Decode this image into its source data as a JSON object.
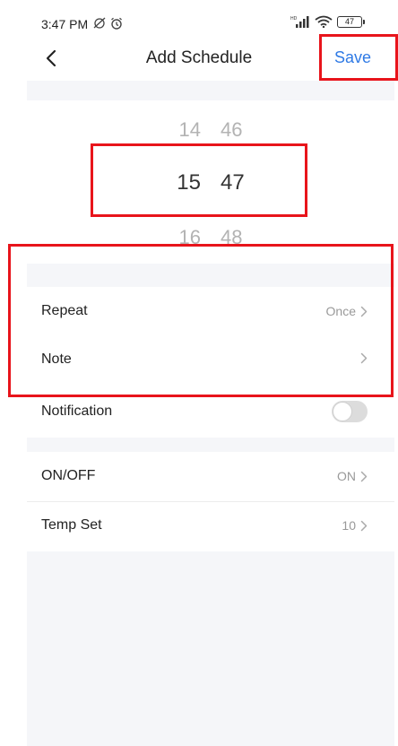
{
  "status_bar": {
    "time": "3:47 PM",
    "icons": [
      "alarm-off-icon",
      "alarm-icon"
    ],
    "battery": "47"
  },
  "header": {
    "title": "Add Schedule",
    "save_label": "Save",
    "back_icon": "chevron-left-icon"
  },
  "time_picker": {
    "previous": {
      "hour": "14",
      "minute": "46"
    },
    "selected": {
      "hour": "15",
      "minute": "47"
    },
    "next": {
      "hour": "16",
      "minute": "48"
    }
  },
  "settings": {
    "repeat": {
      "label": "Repeat",
      "value": "Once"
    },
    "note": {
      "label": "Note",
      "value": ""
    },
    "notification": {
      "label": "Notification",
      "enabled": false
    }
  },
  "actions": {
    "on_off": {
      "label": "ON/OFF",
      "value": "ON"
    },
    "temp_set": {
      "label": "Temp Set",
      "value": "10"
    }
  },
  "colors": {
    "accent": "#2f7ae5",
    "highlight": "#e8141b",
    "section_bg": "#f5f6f9"
  }
}
